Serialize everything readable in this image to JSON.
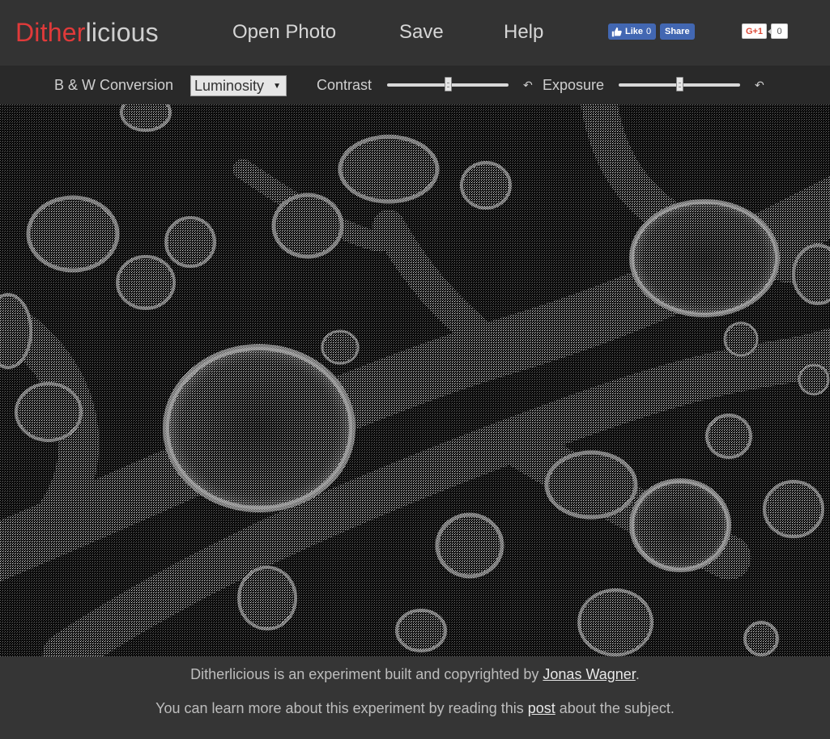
{
  "app": {
    "logo_part1": "Dither",
    "logo_part2": "licious",
    "logo_color_accent": "#e03a3a"
  },
  "nav": {
    "open_photo": "Open Photo",
    "save": "Save",
    "help": "Help"
  },
  "social": {
    "fb_like_label": "Like",
    "fb_like_count": "0",
    "fb_share_label": "Share",
    "gplus_label": "G+1",
    "gplus_count": "0"
  },
  "toolbar": {
    "conversion_label": "B & W Conversion",
    "conversion_value": "Luminosity",
    "contrast_label": "Contrast",
    "contrast_value": 0.5,
    "exposure_label": "Exposure",
    "exposure_value": 0.5,
    "reset_icon": "undo-icon"
  },
  "photo": {
    "description_icon": "dithered-image"
  },
  "footer": {
    "line1_pre": "Ditherlicious is an experiment built and copyrighted by ",
    "line1_link": "Jonas Wagner",
    "line1_post": ".",
    "line2_pre": "You can learn more about this experiment by reading this ",
    "line2_link": "post",
    "line2_post": " about the subject."
  }
}
